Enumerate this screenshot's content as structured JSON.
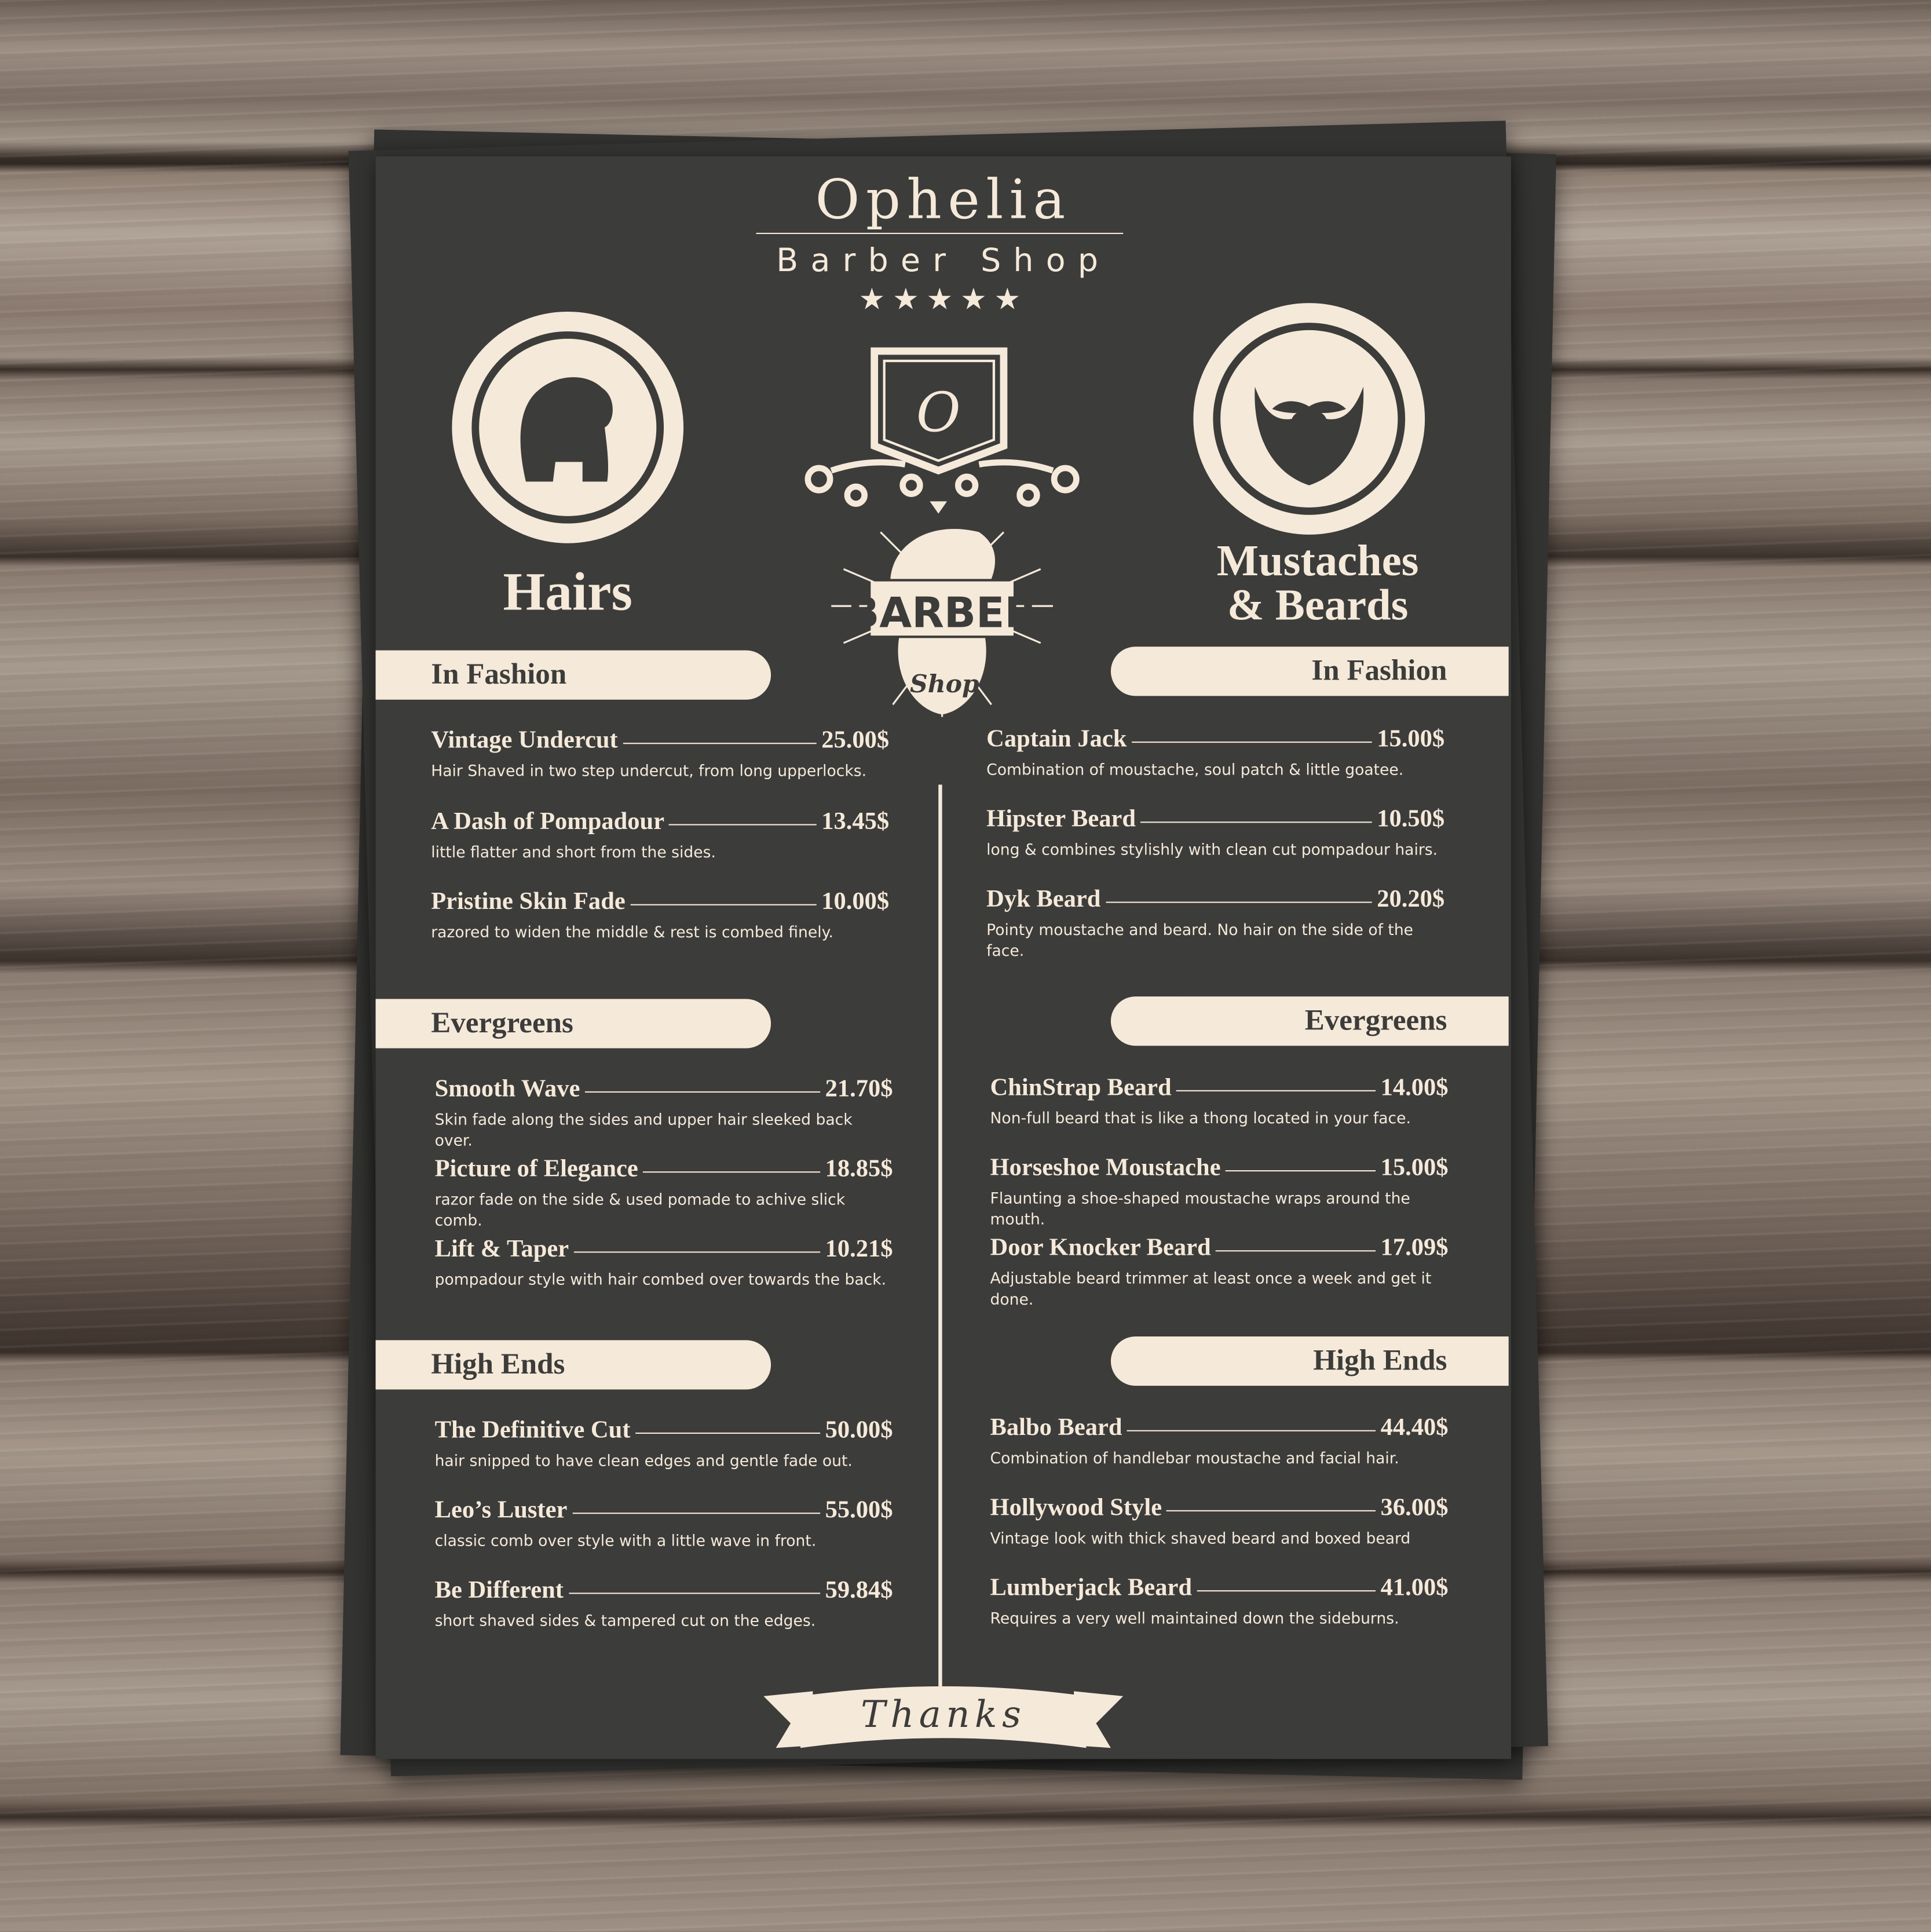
{
  "header": {
    "shop_name": "Ophelia",
    "subtitle": "Barber Shop",
    "stars": "★★★★★",
    "rating": 5
  },
  "logo": {
    "monogram": "O",
    "badge_text": "BARBER",
    "badge_script": "Shop"
  },
  "left": {
    "title": "Hairs",
    "sections": [
      {
        "label": "In Fashion",
        "items": [
          {
            "name": "Vintage Undercut",
            "price": "25.00$",
            "desc": "Hair Shaved in two step undercut, from long upperlocks."
          },
          {
            "name": "A Dash of Pompadour",
            "price": "13.45$",
            "desc": "little flatter and short from the sides."
          },
          {
            "name": "Pristine Skin Fade",
            "price": "10.00$",
            "desc": "razored to widen the middle & rest is combed finely."
          }
        ]
      },
      {
        "label": "Evergreens",
        "items": [
          {
            "name": "Smooth Wave",
            "price": "21.70$",
            "desc": "Skin fade along the sides and upper hair sleeked back over."
          },
          {
            "name": "Picture of Elegance",
            "price": "18.85$",
            "desc": "razor fade on the side & used pomade to achive slick comb."
          },
          {
            "name": "Lift & Taper",
            "price": "10.21$",
            "desc": "pompadour style with hair combed over towards the back."
          }
        ]
      },
      {
        "label": "High Ends",
        "items": [
          {
            "name": "The Definitive Cut",
            "price": "50.00$",
            "desc": "hair snipped to have clean edges and gentle fade out."
          },
          {
            "name": "Leo’s Luster",
            "price": "55.00$",
            "desc": "classic comb over style with a little wave in front."
          },
          {
            "name": "Be Different",
            "price": "59.84$",
            "desc": "short shaved sides & tampered cut on the edges."
          }
        ]
      }
    ]
  },
  "right": {
    "title_line1": "Mustaches",
    "title_line2": "& Beards",
    "sections": [
      {
        "label": "In Fashion",
        "items": [
          {
            "name": "Captain Jack",
            "price": "15.00$",
            "desc": "Combination of moustache, soul patch & little goatee."
          },
          {
            "name": "Hipster Beard",
            "price": "10.50$",
            "desc": "long & combines stylishly with clean cut pompadour hairs."
          },
          {
            "name": "Dyk Beard",
            "price": "20.20$",
            "desc": "Pointy moustache and beard. No hair on the side of the face."
          }
        ]
      },
      {
        "label": "Evergreens",
        "items": [
          {
            "name": "ChinStrap Beard",
            "price": "14.00$",
            "desc": "Non-full beard that is like a thong located in your face."
          },
          {
            "name": "Horseshoe Moustache",
            "price": "15.00$",
            "desc": "Flaunting a shoe-shaped moustache wraps around the mouth."
          },
          {
            "name": "Door Knocker Beard",
            "price": "17.09$",
            "desc": "Adjustable beard trimmer at least once a week and get it done."
          }
        ]
      },
      {
        "label": "High Ends",
        "items": [
          {
            "name": "Balbo Beard",
            "price": "44.40$",
            "desc": "Combination of handlebar moustache  and facial hair."
          },
          {
            "name": "Hollywood Style",
            "price": "36.00$",
            "desc": "Vintage look with thick shaved beard and boxed beard"
          },
          {
            "name": "Lumberjack Beard",
            "price": "41.00$",
            "desc": "Requires a very well maintained down the sideburns."
          }
        ]
      }
    ]
  },
  "footer": {
    "thanks": "Thanks"
  },
  "colors": {
    "paper": "#3c3c3a",
    "cream": "#f5e9da"
  }
}
